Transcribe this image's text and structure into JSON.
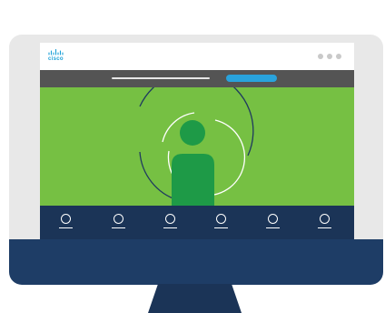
{
  "brand": {
    "logo_text": "cisco",
    "logo_color": "#1ba0d7"
  },
  "colors": {
    "bezel": "#e8e8e8",
    "monitor_base": "#1e3d66",
    "nav_bar": "#545454",
    "nav_button": "#29a3dc",
    "hero_background": "#76c043",
    "person": "#1e9a47",
    "footer_bar": "#1b3457",
    "window_dots": "#c9c9c9"
  },
  "icons": {
    "logo": "cisco-bridge-logo",
    "window_controls": "three-dots",
    "hero_figure": "person-silhouette-with-signal-rings",
    "footer_items": [
      "circle-icon",
      "circle-icon",
      "circle-icon",
      "circle-icon",
      "circle-icon",
      "circle-icon"
    ]
  }
}
